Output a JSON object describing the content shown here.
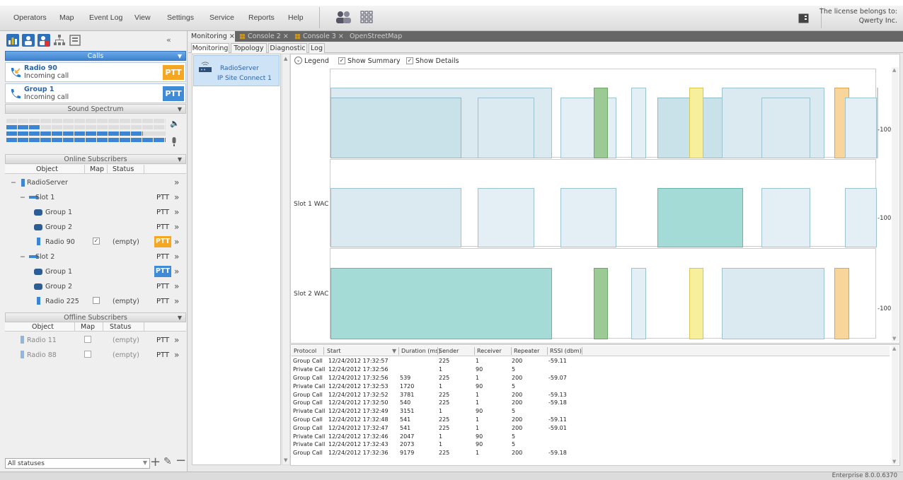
{
  "menu": [
    "Operators",
    "Map",
    "Event Log",
    "View",
    "Settings",
    "Service",
    "Reports",
    "Help"
  ],
  "license": {
    "line1": "The license belongs to:",
    "line2": "Qwerty Inc."
  },
  "left": {
    "calls_header": "Calls",
    "calls": [
      {
        "title": "Radio 90",
        "subtitle": "Incoming call",
        "ptt": "PTT",
        "ptt_color": "#f5a623"
      },
      {
        "title": "Group 1",
        "subtitle": "Incoming call",
        "ptt": "PTT",
        "ptt_color": "#3f8bd6"
      }
    ],
    "sound_header": "Sound Spectrum",
    "online_header": "Online Subscribers",
    "columns": [
      "Object",
      "Map",
      "Status"
    ],
    "online": [
      {
        "label": "RadioServer",
        "ptt": ""
      },
      {
        "label": "Slot 1",
        "ptt": "PTT"
      },
      {
        "label": "Group 1",
        "ptt": "PTT"
      },
      {
        "label": "Group 2",
        "ptt": "PTT"
      },
      {
        "label": "Radio 90",
        "status": "(empty)",
        "ptt": "PTT"
      },
      {
        "label": "Slot 2",
        "ptt": "PTT"
      },
      {
        "label": "Group 1",
        "ptt": "PTT"
      },
      {
        "label": "Group 2",
        "ptt": "PTT"
      },
      {
        "label": "Radio 225",
        "status": "(empty)",
        "ptt": "PTT"
      }
    ],
    "offline_header": "Offline Subscribers",
    "offline": [
      {
        "label": "Radio 11",
        "status": "(empty)",
        "ptt": "PTT"
      },
      {
        "label": "Radio 88",
        "status": "(empty)",
        "ptt": "PTT"
      }
    ],
    "filter_value": "All statuses"
  },
  "doc_tabs": [
    "Monitoring",
    "Console 2",
    "Console 3",
    "OpenStreetMap"
  ],
  "sub_tabs": [
    "Monitoring",
    "Topology",
    "Diagnostic",
    "Log"
  ],
  "tree": {
    "server": "RadioServer",
    "node": "IP Site Connect 1"
  },
  "chart": {
    "legend": "Legend",
    "show_summary": "Show Summary",
    "show_details": "Show Details",
    "row_labels": [
      "",
      "Slot 1 WAC",
      "Slot 2 WAC"
    ],
    "axis_value": "-100"
  },
  "log": {
    "headers": [
      "Protocol",
      "Start",
      "Duration (ms)",
      "Sender",
      "Receiver",
      "Repeater",
      "RSSI (dbm)"
    ],
    "rows": [
      [
        "Group Call",
        "12/24/2012 17:32:57",
        "",
        "225",
        "1",
        "200",
        "-59.11"
      ],
      [
        "Private Call",
        "12/24/2012 17:32:56",
        "",
        "1",
        "90",
        "5",
        ""
      ],
      [
        "Group Call",
        "12/24/2012 17:32:56",
        "539",
        "225",
        "1",
        "200",
        "-59.07"
      ],
      [
        "Private Call",
        "12/24/2012 17:32:53",
        "1720",
        "1",
        "90",
        "5",
        ""
      ],
      [
        "Group Call",
        "12/24/2012 17:32:52",
        "3781",
        "225",
        "1",
        "200",
        "-59.13"
      ],
      [
        "Group Call",
        "12/24/2012 17:32:50",
        "540",
        "225",
        "1",
        "200",
        "-59.18"
      ],
      [
        "Private Call",
        "12/24/2012 17:32:49",
        "3151",
        "1",
        "90",
        "5",
        ""
      ],
      [
        "Group Call",
        "12/24/2012 17:32:48",
        "541",
        "225",
        "1",
        "200",
        "-59.11"
      ],
      [
        "Group Call",
        "12/24/2012 17:32:47",
        "541",
        "225",
        "1",
        "200",
        "-59.01"
      ],
      [
        "Private Call",
        "12/24/2012 17:32:46",
        "2047",
        "1",
        "90",
        "5",
        ""
      ],
      [
        "Private Call",
        "12/24/2012 17:32:43",
        "2073",
        "1",
        "90",
        "5",
        ""
      ],
      [
        "Group Call",
        "12/24/2012 17:32:36",
        "9179",
        "225",
        "1",
        "200",
        "-59.18"
      ]
    ]
  },
  "version": "Enterprise 8.0.0.6370"
}
